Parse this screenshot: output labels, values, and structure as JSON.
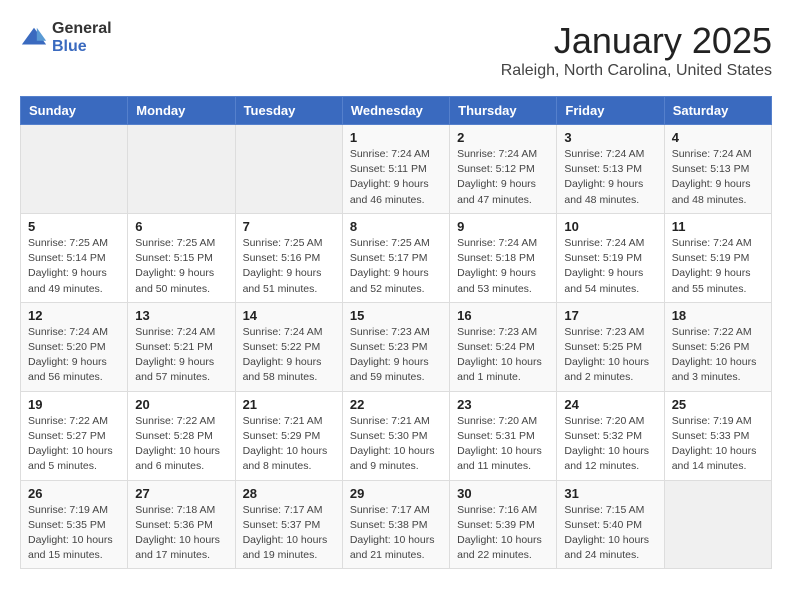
{
  "logo": {
    "general": "General",
    "blue": "Blue"
  },
  "header": {
    "month": "January 2025",
    "location": "Raleigh, North Carolina, United States"
  },
  "weekdays": [
    "Sunday",
    "Monday",
    "Tuesday",
    "Wednesday",
    "Thursday",
    "Friday",
    "Saturday"
  ],
  "weeks": [
    [
      {
        "day": "",
        "info": ""
      },
      {
        "day": "",
        "info": ""
      },
      {
        "day": "",
        "info": ""
      },
      {
        "day": "1",
        "info": "Sunrise: 7:24 AM\nSunset: 5:11 PM\nDaylight: 9 hours and 46 minutes."
      },
      {
        "day": "2",
        "info": "Sunrise: 7:24 AM\nSunset: 5:12 PM\nDaylight: 9 hours and 47 minutes."
      },
      {
        "day": "3",
        "info": "Sunrise: 7:24 AM\nSunset: 5:13 PM\nDaylight: 9 hours and 48 minutes."
      },
      {
        "day": "4",
        "info": "Sunrise: 7:24 AM\nSunset: 5:13 PM\nDaylight: 9 hours and 48 minutes."
      }
    ],
    [
      {
        "day": "5",
        "info": "Sunrise: 7:25 AM\nSunset: 5:14 PM\nDaylight: 9 hours and 49 minutes."
      },
      {
        "day": "6",
        "info": "Sunrise: 7:25 AM\nSunset: 5:15 PM\nDaylight: 9 hours and 50 minutes."
      },
      {
        "day": "7",
        "info": "Sunrise: 7:25 AM\nSunset: 5:16 PM\nDaylight: 9 hours and 51 minutes."
      },
      {
        "day": "8",
        "info": "Sunrise: 7:25 AM\nSunset: 5:17 PM\nDaylight: 9 hours and 52 minutes."
      },
      {
        "day": "9",
        "info": "Sunrise: 7:24 AM\nSunset: 5:18 PM\nDaylight: 9 hours and 53 minutes."
      },
      {
        "day": "10",
        "info": "Sunrise: 7:24 AM\nSunset: 5:19 PM\nDaylight: 9 hours and 54 minutes."
      },
      {
        "day": "11",
        "info": "Sunrise: 7:24 AM\nSunset: 5:19 PM\nDaylight: 9 hours and 55 minutes."
      }
    ],
    [
      {
        "day": "12",
        "info": "Sunrise: 7:24 AM\nSunset: 5:20 PM\nDaylight: 9 hours and 56 minutes."
      },
      {
        "day": "13",
        "info": "Sunrise: 7:24 AM\nSunset: 5:21 PM\nDaylight: 9 hours and 57 minutes."
      },
      {
        "day": "14",
        "info": "Sunrise: 7:24 AM\nSunset: 5:22 PM\nDaylight: 9 hours and 58 minutes."
      },
      {
        "day": "15",
        "info": "Sunrise: 7:23 AM\nSunset: 5:23 PM\nDaylight: 9 hours and 59 minutes."
      },
      {
        "day": "16",
        "info": "Sunrise: 7:23 AM\nSunset: 5:24 PM\nDaylight: 10 hours and 1 minute."
      },
      {
        "day": "17",
        "info": "Sunrise: 7:23 AM\nSunset: 5:25 PM\nDaylight: 10 hours and 2 minutes."
      },
      {
        "day": "18",
        "info": "Sunrise: 7:22 AM\nSunset: 5:26 PM\nDaylight: 10 hours and 3 minutes."
      }
    ],
    [
      {
        "day": "19",
        "info": "Sunrise: 7:22 AM\nSunset: 5:27 PM\nDaylight: 10 hours and 5 minutes."
      },
      {
        "day": "20",
        "info": "Sunrise: 7:22 AM\nSunset: 5:28 PM\nDaylight: 10 hours and 6 minutes."
      },
      {
        "day": "21",
        "info": "Sunrise: 7:21 AM\nSunset: 5:29 PM\nDaylight: 10 hours and 8 minutes."
      },
      {
        "day": "22",
        "info": "Sunrise: 7:21 AM\nSunset: 5:30 PM\nDaylight: 10 hours and 9 minutes."
      },
      {
        "day": "23",
        "info": "Sunrise: 7:20 AM\nSunset: 5:31 PM\nDaylight: 10 hours and 11 minutes."
      },
      {
        "day": "24",
        "info": "Sunrise: 7:20 AM\nSunset: 5:32 PM\nDaylight: 10 hours and 12 minutes."
      },
      {
        "day": "25",
        "info": "Sunrise: 7:19 AM\nSunset: 5:33 PM\nDaylight: 10 hours and 14 minutes."
      }
    ],
    [
      {
        "day": "26",
        "info": "Sunrise: 7:19 AM\nSunset: 5:35 PM\nDaylight: 10 hours and 15 minutes."
      },
      {
        "day": "27",
        "info": "Sunrise: 7:18 AM\nSunset: 5:36 PM\nDaylight: 10 hours and 17 minutes."
      },
      {
        "day": "28",
        "info": "Sunrise: 7:17 AM\nSunset: 5:37 PM\nDaylight: 10 hours and 19 minutes."
      },
      {
        "day": "29",
        "info": "Sunrise: 7:17 AM\nSunset: 5:38 PM\nDaylight: 10 hours and 21 minutes."
      },
      {
        "day": "30",
        "info": "Sunrise: 7:16 AM\nSunset: 5:39 PM\nDaylight: 10 hours and 22 minutes."
      },
      {
        "day": "31",
        "info": "Sunrise: 7:15 AM\nSunset: 5:40 PM\nDaylight: 10 hours and 24 minutes."
      },
      {
        "day": "",
        "info": ""
      }
    ]
  ]
}
